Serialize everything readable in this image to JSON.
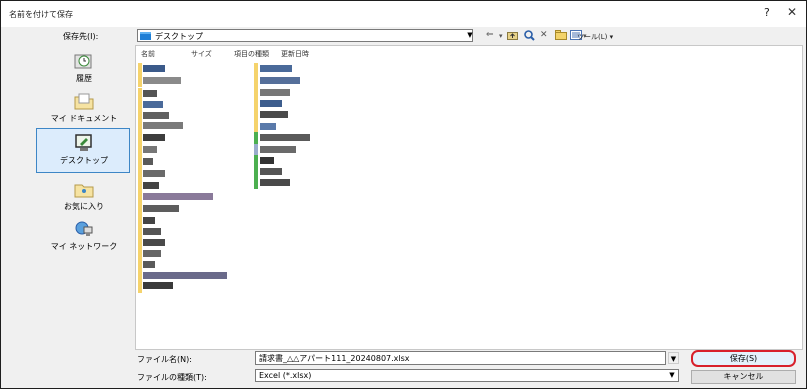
{
  "window": {
    "title": "名前を付けて保存",
    "help_glyph": "?",
    "close_glyph": "✕"
  },
  "save_in": {
    "label": "保存先(I):",
    "value": "デスクトップ"
  },
  "toolbar": {
    "tools_label": "ツール(L)"
  },
  "places": [
    {
      "label": "履歴",
      "icon": "history-icon"
    },
    {
      "label": "マイ ドキュメント",
      "icon": "my-documents-icon"
    },
    {
      "label": "デスクトップ",
      "icon": "desktop-icon",
      "selected": true
    },
    {
      "label": "お気に入り",
      "icon": "favorites-icon"
    },
    {
      "label": "マイ ネットワーク",
      "icon": "my-network-icon"
    }
  ],
  "file_list": {
    "columns": [
      "名前",
      "サイズ",
      "項目の種類",
      "更新日時"
    ]
  },
  "file_name": {
    "label": "ファイル名(N):",
    "value": "請求書_△△アパート111_20240807.xlsx"
  },
  "file_type": {
    "label": "ファイルの種類(T):",
    "value": "Excel (*.xlsx)"
  },
  "buttons": {
    "save": "保存(S)",
    "cancel": "キャンセル"
  },
  "colors": {
    "highlight_outline": "#d8202b",
    "selected_place_bg": "#dcecfc",
    "folder_blue": "#1e7fd6"
  }
}
